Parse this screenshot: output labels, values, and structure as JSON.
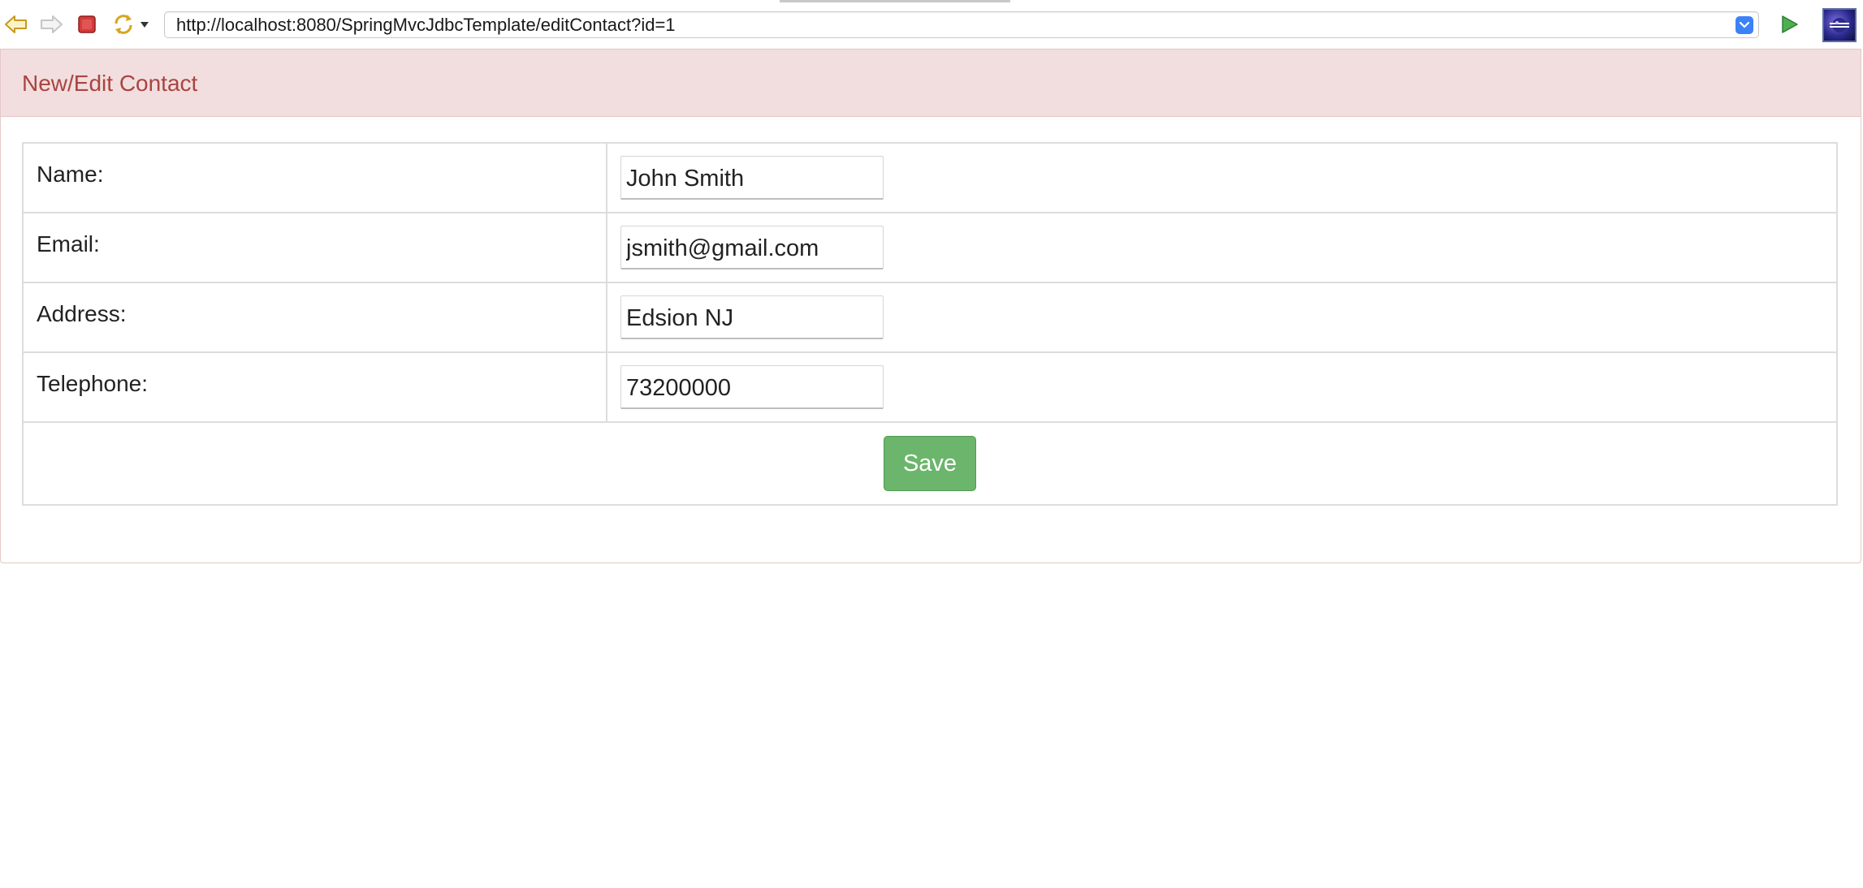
{
  "browser": {
    "url": "http://localhost:8080/SpringMvcJdbcTemplate/editContact?id=1",
    "icons": {
      "back": "back-arrow-icon",
      "forward": "forward-arrow-icon",
      "stop": "stop-icon",
      "refresh": "refresh-icon",
      "refresh_menu": "dropdown-triangle-icon",
      "url_dropdown": "chevron-down-icon",
      "go": "go-play-icon",
      "logo": "eclipse-logo-icon"
    }
  },
  "panel": {
    "title": "New/Edit Contact"
  },
  "form": {
    "fields": [
      {
        "label": "Name:",
        "value": "John Smith"
      },
      {
        "label": "Email:",
        "value": "jsmith@gmail.com"
      },
      {
        "label": "Address:",
        "value": "Edsion NJ"
      },
      {
        "label": "Telephone:",
        "value": "73200000"
      }
    ],
    "save_label": "Save"
  },
  "colors": {
    "heading_bg": "#f2dede",
    "heading_text": "#a94442",
    "save_button": "#6cb56c",
    "url_dropdown": "#3b82f6"
  }
}
